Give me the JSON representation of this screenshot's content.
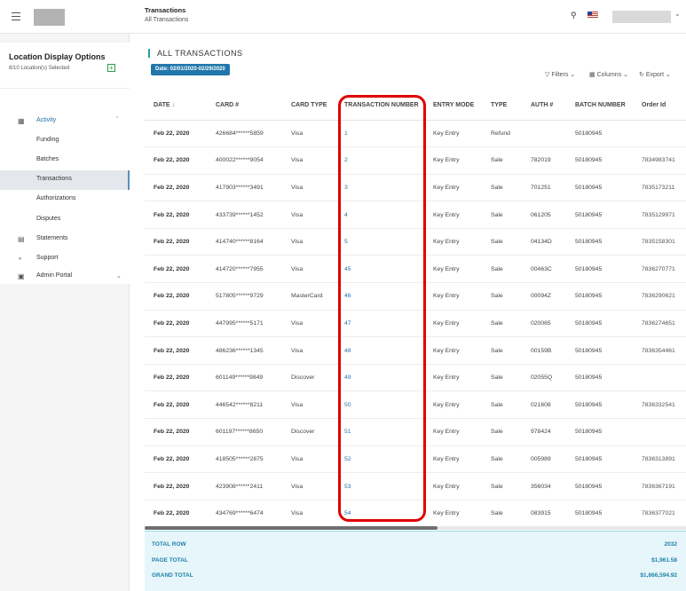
{
  "header": {
    "breadcrumb_title": "Transactions",
    "breadcrumb_sub": "All Transactions"
  },
  "sidebar": {
    "title": "Location Display Options",
    "subtitle": "8/10 Location(s) Selected",
    "add_icon": "+",
    "items": [
      {
        "label": "Activity",
        "icon": "chart-icon"
      },
      {
        "label": "Funding"
      },
      {
        "label": "Batches"
      },
      {
        "label": "Transactions"
      },
      {
        "label": "Authorizations"
      },
      {
        "label": "Disputes"
      },
      {
        "label": "Statements",
        "icon": "document-icon"
      },
      {
        "label": "Support",
        "icon": "support-icon"
      },
      {
        "label": "Admin Portal",
        "icon": "admin-icon"
      }
    ]
  },
  "main": {
    "title": "ALL TRANSACTIONS",
    "date_badge": "Date: 02/01/2020-02/29/2020",
    "toolbar": {
      "filters": "Filters",
      "columns": "Columns",
      "export": "Export"
    },
    "columns": [
      "DATE",
      "CARD #",
      "CARD TYPE",
      "TRANSACTION NUMBER",
      "ENTRY MODE",
      "TYPE",
      "AUTH #",
      "BATCH NUMBER",
      "Order Id"
    ],
    "rows": [
      [
        "Feb 22, 2020",
        "426684******5859",
        "Visa",
        "1",
        "Key Entry",
        "Refund",
        "",
        "50180945",
        ""
      ],
      [
        "Feb 22, 2020",
        "400022******9054",
        "Visa",
        "2",
        "Key Entry",
        "Sale",
        "782019",
        "50180945",
        "7834983741"
      ],
      [
        "Feb 22, 2020",
        "417903******3491",
        "Visa",
        "3",
        "Key Entry",
        "Sale",
        "701251",
        "50180945",
        "7835173211"
      ],
      [
        "Feb 22, 2020",
        "433739******1452",
        "Visa",
        "4",
        "Key Entry",
        "Sale",
        "061205",
        "50180945",
        "7835129971"
      ],
      [
        "Feb 22, 2020",
        "414740******8164",
        "Visa",
        "5",
        "Key Entry",
        "Sale",
        "04134D",
        "50180945",
        "7835158301"
      ],
      [
        "Feb 22, 2020",
        "414720******7955",
        "Visa",
        "45",
        "Key Entry",
        "Sale",
        "00463C",
        "50180945",
        "7836270771"
      ],
      [
        "Feb 22, 2020",
        "517805******9729",
        "MasterCard",
        "46",
        "Key Entry",
        "Sale",
        "00094Z",
        "50180945",
        "7836290621"
      ],
      [
        "Feb 22, 2020",
        "447995******5171",
        "Visa",
        "47",
        "Key Entry",
        "Sale",
        "020065",
        "50180945",
        "7836274651"
      ],
      [
        "Feb 22, 2020",
        "486236******1345",
        "Visa",
        "48",
        "Key Entry",
        "Sale",
        "00159B",
        "50180945",
        "7836354461"
      ],
      [
        "Feb 22, 2020",
        "601149******9849",
        "Discover",
        "49",
        "Key Entry",
        "Sale",
        "02055Q",
        "50180945",
        ""
      ],
      [
        "Feb 22, 2020",
        "446542******8211",
        "Visa",
        "50",
        "Key Entry",
        "Sale",
        "021608",
        "50180945",
        "7836332541"
      ],
      [
        "Feb 22, 2020",
        "601197******8650",
        "Discover",
        "51",
        "Key Entry",
        "Sale",
        "978424",
        "50180945",
        ""
      ],
      [
        "Feb 22, 2020",
        "418505******2875",
        "Visa",
        "52",
        "Key Entry",
        "Sale",
        "005989",
        "50180945",
        "7836313891"
      ],
      [
        "Feb 22, 2020",
        "423908******2411",
        "Visa",
        "53",
        "Key Entry",
        "Sale",
        "356034",
        "50180945",
        "7836367191"
      ],
      [
        "Feb 22, 2020",
        "434769******6474",
        "Visa",
        "54",
        "Key Entry",
        "Sale",
        "083915",
        "50180945",
        "7836377021"
      ]
    ],
    "totals": [
      {
        "label": "TOTAL ROW",
        "value": "2032"
      },
      {
        "label": "PAGE TOTAL",
        "value": "$1,961.58"
      },
      {
        "label": "GRAND TOTAL",
        "value": "$1,866,594.92"
      }
    ]
  },
  "colors": {
    "accent": "#2277aa",
    "highlight": "#e00000",
    "totals_bg": "#e6f6fb"
  }
}
